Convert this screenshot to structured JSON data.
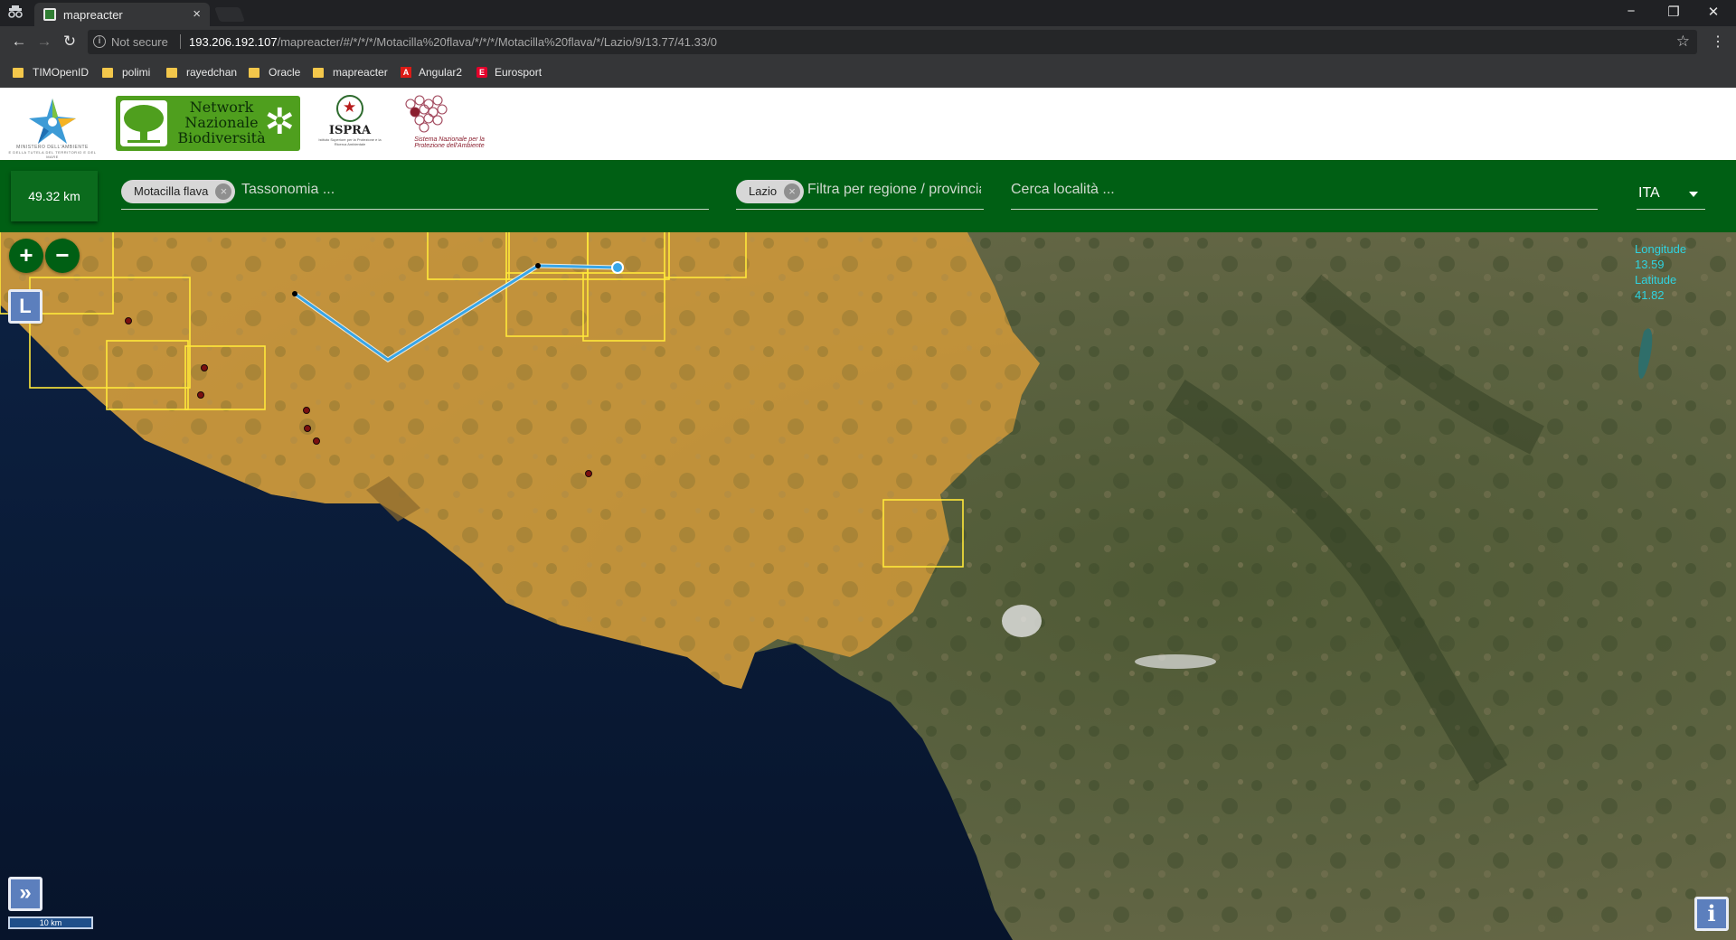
{
  "browser": {
    "tab_title": "mapreacter",
    "tab_close": "×",
    "security_label": "Not secure",
    "url_host": "193.206.192.107",
    "url_path": "/mapreacter/#/*/*/*/Motacilla%20flava/*/*/*/Motacilla%20flava/*/Lazio/9/13.77/41.33/0",
    "bookmarks": [
      {
        "label": "TIMOpenID",
        "icon": "folder-icon"
      },
      {
        "label": "polimi",
        "icon": "folder-icon"
      },
      {
        "label": "rayedchan",
        "icon": "folder-icon"
      },
      {
        "label": "Oracle",
        "icon": "folder-icon"
      },
      {
        "label": "mapreacter",
        "icon": "folder-icon"
      },
      {
        "label": "Angular2",
        "icon": "angular-icon"
      },
      {
        "label": "Eurosport",
        "icon": "eurosport-icon"
      }
    ]
  },
  "header": {
    "ministry_logo_text": "MINISTERO DELL'AMBIENTE",
    "ministry_logo_subtext": "E DELLA TUTELA DEL TERRITORIO E DEL MARE",
    "nnb_logo_text": "Network Nazionale Biodiversità",
    "ispra_logo_text": "ISPRA",
    "ispra_logo_subtext": "Istituto Superiore per la Protezione e la Ricerca Ambientale",
    "snpa_logo_text": "Sistema Nazionale per la Protezione dell'Ambiente"
  },
  "filterbar": {
    "distance": "49.32 km",
    "taxonomy_chip": "Motacilla flava",
    "taxonomy_placeholder": "Tassonomia ...",
    "region_chip": "Lazio",
    "region_placeholder": "Filtra per regione / provincia",
    "locality_placeholder": "Cerca località ...",
    "language": "ITA"
  },
  "map": {
    "zoom_in": "+",
    "zoom_out": "−",
    "layer_button": "L",
    "coords_longitude_label": "Longitude",
    "coords_longitude_value": "13.59",
    "coords_latitude_label": "Latitude",
    "coords_latitude_value": "41.82",
    "expand_button": "»",
    "scale_label": "10 km",
    "info_button": "i"
  },
  "colors": {
    "brand_green": "#005f14",
    "region_overlay": "#d29a3a",
    "grid_yellow": "#ffe83a",
    "measure_line": "#38a6e8",
    "coords_text": "#2fd3e0"
  }
}
